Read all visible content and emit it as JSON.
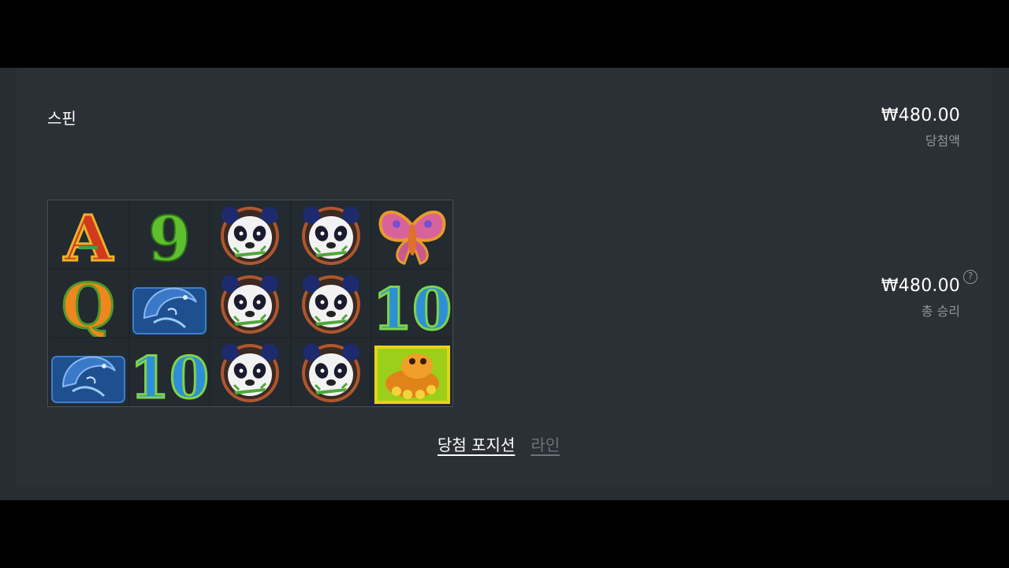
{
  "header": {
    "title": "스핀"
  },
  "win": {
    "amount": "₩480.00",
    "label": "당첨액"
  },
  "total": {
    "amount": "₩480.00",
    "label": "총 승리",
    "help_icon": "question-circle-icon",
    "help_glyph": "?"
  },
  "reels": {
    "rows": [
      [
        "A",
        "9",
        "panda",
        "panda",
        "butterfly"
      ],
      [
        "Q",
        "koi-fish",
        "panda",
        "panda",
        "10"
      ],
      [
        "koi-fish",
        "10",
        "panda",
        "panda",
        "golden-toad"
      ]
    ]
  },
  "tabs": [
    {
      "label": "당첨 포지션",
      "active": true
    },
    {
      "label": "라인",
      "active": false
    }
  ],
  "colors": {
    "background": "#000000",
    "panel": "#2a3035",
    "text": "#ffffff",
    "muted": "#8e969c"
  }
}
